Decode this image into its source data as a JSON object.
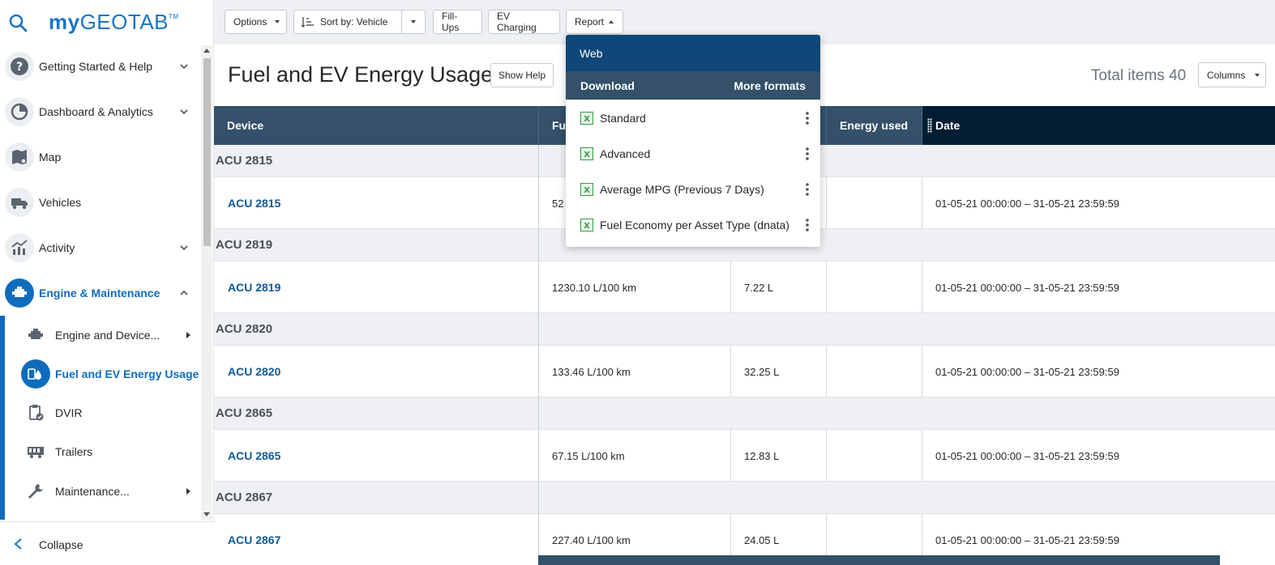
{
  "logo": {
    "my": "my",
    "rest": "GEOTAB",
    "tm": "TM"
  },
  "sidebar": {
    "items": [
      {
        "label": "Getting Started & Help",
        "icon": "help-icon",
        "expandable": true
      },
      {
        "label": "Dashboard & Analytics",
        "icon": "dashboard-icon",
        "expandable": true
      },
      {
        "label": "Map",
        "icon": "map-icon",
        "expandable": false
      },
      {
        "label": "Vehicles",
        "icon": "truck-icon",
        "expandable": false
      },
      {
        "label": "Activity",
        "icon": "activity-chart-icon",
        "expandable": true
      },
      {
        "label": "Engine & Maintenance",
        "icon": "engine-icon",
        "expandable": true,
        "active": true
      }
    ],
    "subitems": [
      {
        "label": "Engine and Device...",
        "icon": "engine-icon",
        "submenu": true
      },
      {
        "label": "Fuel and EV Energy Usage",
        "icon": "fuel-drop-icon",
        "active": true
      },
      {
        "label": "DVIR",
        "icon": "clipboard-check-icon"
      },
      {
        "label": "Trailers",
        "icon": "trailer-icon"
      },
      {
        "label": "Maintenance...",
        "icon": "wrench-icon",
        "submenu": true
      }
    ],
    "collapse_label": "Collapse"
  },
  "toolbar": {
    "options_label": "Options",
    "sort_prefix": "Sort by:",
    "sort_value": "Vehicle",
    "fillups_label": "Fill-Ups",
    "ev_label": "EV Charging",
    "report_label": "Report"
  },
  "page": {
    "title": "Fuel and EV Energy Usage",
    "help_label": "Show Help",
    "total_label": "Total items 40",
    "columns_label": "Columns"
  },
  "grid": {
    "headers": {
      "device": "Device",
      "fuel": "Fu",
      "energy": "Energy used",
      "date": "Date"
    },
    "groups": [
      {
        "group": "ACU 2815",
        "device": "ACU 2815",
        "fuel": "52",
        "volume": "",
        "energy": "",
        "date": "01-05-21 00:00:00 – 31-05-21 23:59:59"
      },
      {
        "group": "ACU 2819",
        "device": "ACU 2819",
        "fuel": "1230.10 L/100 km",
        "volume": "7.22 L",
        "energy": "",
        "date": "01-05-21 00:00:00 – 31-05-21 23:59:59"
      },
      {
        "group": "ACU 2820",
        "device": "ACU 2820",
        "fuel": "133.46 L/100 km",
        "volume": "32.25 L",
        "energy": "",
        "date": "01-05-21 00:00:00 – 31-05-21 23:59:59"
      },
      {
        "group": "ACU 2865",
        "device": "ACU 2865",
        "fuel": "67.15 L/100 km",
        "volume": "12.83 L",
        "energy": "",
        "date": "01-05-21 00:00:00 – 31-05-21 23:59:59"
      },
      {
        "group": "ACU 2867",
        "device": "ACU 2867",
        "fuel": "227.40 L/100 km",
        "volume": "24.05 L",
        "energy": "",
        "date": "01-05-21 00:00:00 – 31-05-21 23:59:59"
      }
    ]
  },
  "report_menu": {
    "web_label": "Web",
    "download_label": "Download",
    "more_formats_label": "More formats",
    "items": [
      "Standard",
      "Advanced",
      "Average MPG (Previous 7 Days)",
      "Fuel Economy per Asset Type (dnata)"
    ]
  },
  "colors": {
    "accent": "#0f6cbd",
    "header": "#34506a",
    "header_dark": "#021d33",
    "menu_web": "#0e4778"
  }
}
